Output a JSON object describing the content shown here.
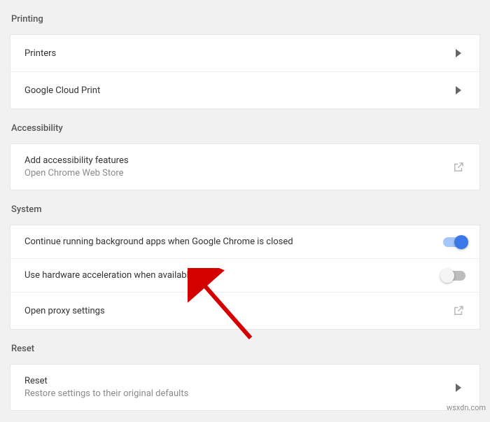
{
  "sections": {
    "printing": {
      "header": "Printing",
      "printers": "Printers",
      "cloud_print": "Google Cloud Print"
    },
    "accessibility": {
      "header": "Accessibility",
      "add_title": "Add accessibility features",
      "add_sub": "Open Chrome Web Store"
    },
    "system": {
      "header": "System",
      "bg_apps": "Continue running background apps when Google Chrome is closed",
      "hw_accel": "Use hardware acceleration when available",
      "proxy": "Open proxy settings"
    },
    "reset": {
      "header": "Reset",
      "reset_title": "Reset",
      "reset_sub": "Restore settings to their original defaults"
    }
  },
  "watermark": "wsxdn.com"
}
